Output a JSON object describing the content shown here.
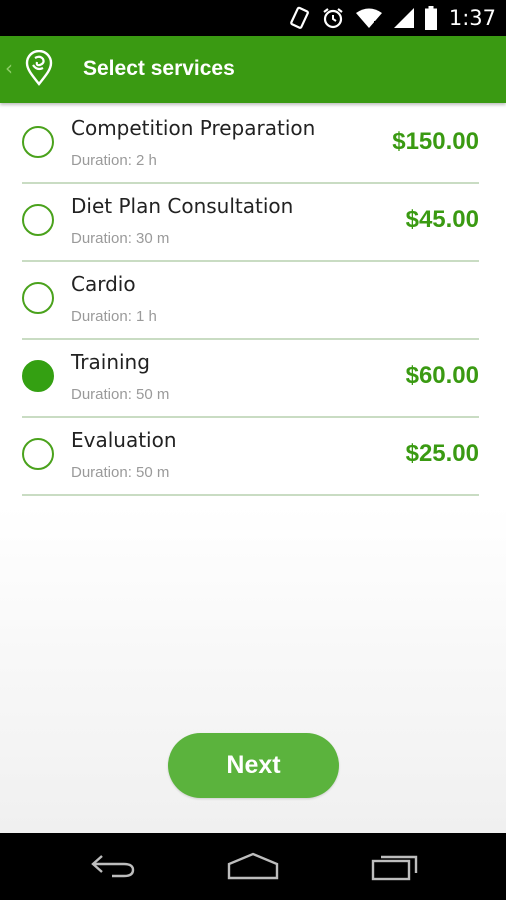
{
  "status_bar": {
    "time": "1:37",
    "icons": [
      "phone-vibrate-icon",
      "alarm-icon",
      "wifi-icon",
      "cell-signal-icon",
      "battery-icon"
    ]
  },
  "action_bar": {
    "title": "Select services",
    "back_icon": "chevron-left-icon",
    "logo_icon": "app-logo-icon",
    "color": "#3a9a12"
  },
  "services": [
    {
      "name": "Competition Preparation",
      "duration": "Duration: 2 h",
      "price": "$150.00",
      "selected": false
    },
    {
      "name": "Diet Plan Consultation",
      "duration": "Duration: 30 m",
      "price": "$45.00",
      "selected": false
    },
    {
      "name": "Cardio",
      "duration": "Duration: 1 h",
      "price": "",
      "selected": false
    },
    {
      "name": "Training",
      "duration": "Duration: 50 m",
      "price": "$60.00",
      "selected": true
    },
    {
      "name": "Evaluation",
      "duration": "Duration: 50 m",
      "price": "$25.00",
      "selected": false
    }
  ],
  "next_button": {
    "label": "Next",
    "color": "#5bb33d"
  },
  "nav_bar": {
    "icons": [
      "back-icon",
      "home-icon",
      "recent-apps-icon"
    ]
  }
}
